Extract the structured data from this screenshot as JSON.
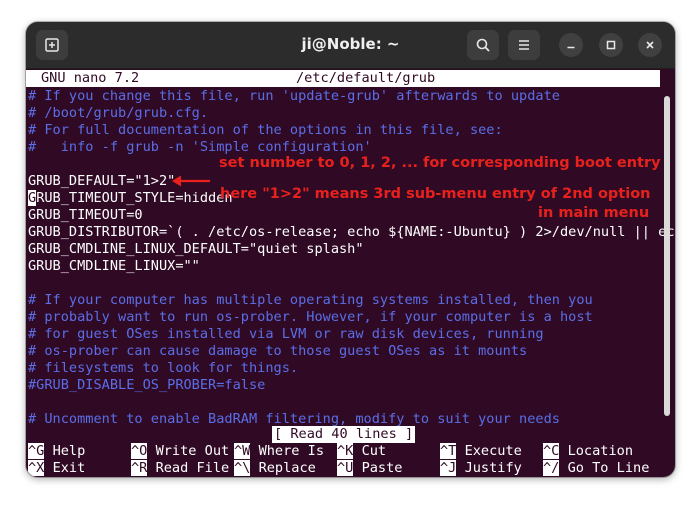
{
  "window": {
    "title": "ji@Noble: ~",
    "icons": [
      "new-tab-icon",
      "search-icon",
      "hamburger-menu-icon",
      "minimize-icon",
      "maximize-icon",
      "close-icon"
    ]
  },
  "nano": {
    "version": "GNU nano 7.2",
    "filename": "/etc/default/grub",
    "status": "[ Read 40 lines ]"
  },
  "lines": [
    "# If you change this file, run 'update-grub' afterwards to update",
    "# /boot/grub/grub.cfg.",
    "# For full documentation of the options in this file, see:",
    "#   info -f grub -n 'Simple configuration'",
    "",
    "GRUB_DEFAULT=\"1>2\"",
    "RUB_TIMEOUT_STYLE=hidden",
    "GRUB_TIMEOUT=0",
    "GRUB_DISTRIBUTOR=`( . /etc/os-release; echo ${NAME:-Ubuntu} ) 2>/dev/null || ec",
    "GRUB_CMDLINE_LINUX_DEFAULT=\"quiet splash\"",
    "GRUB_CMDLINE_LINUX=\"\"",
    "",
    "# If your computer has multiple operating systems installed, then you",
    "# probably want to run os-prober. However, if your computer is a host",
    "# for guest OSes installed via LVM or raw disk devices, running",
    "# os-prober can cause damage to those guest OSes as it mounts",
    "# filesystems to look for things.",
    "#GRUB_DISABLE_OS_PROBER=false",
    "",
    "# Uncomment to enable BadRAM filtering, modify to suit your needs"
  ],
  "cursor_char": "G",
  "overflow_marker": ">",
  "shortcuts": [
    {
      "key": "^G",
      "label": "Help"
    },
    {
      "key": "^O",
      "label": "Write Out"
    },
    {
      "key": "^W",
      "label": "Where Is"
    },
    {
      "key": "^K",
      "label": "Cut"
    },
    {
      "key": "^T",
      "label": "Execute"
    },
    {
      "key": "^C",
      "label": "Location"
    },
    {
      "key": "^X",
      "label": "Exit"
    },
    {
      "key": "^R",
      "label": "Read File"
    },
    {
      "key": "^\\",
      "label": "Replace"
    },
    {
      "key": "^U",
      "label": "Paste"
    },
    {
      "key": "^J",
      "label": "Justify"
    },
    {
      "key": "^/",
      "label": "Go To Line"
    }
  ],
  "annotations": {
    "line1": "set number to 0, 1, 2, ... for corresponding boot entry",
    "line2": "here \"1>2\" means 3rd sub-menu entry of 2nd option",
    "line3": "in main menu",
    "color": "#e8211d"
  },
  "colors": {
    "terminal_bg": "#300a24",
    "comment": "#5a6ee8",
    "titlebar": "#2c2c2c"
  }
}
